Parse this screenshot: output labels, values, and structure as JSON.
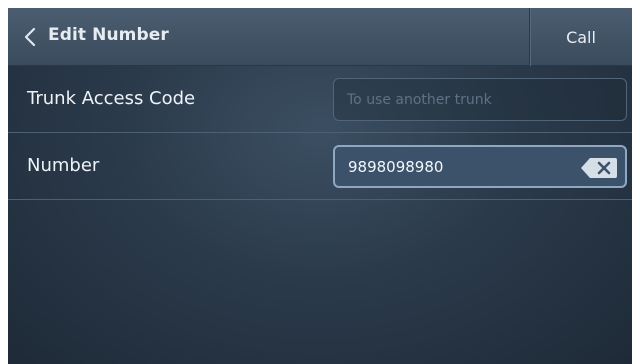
{
  "header": {
    "title": "Edit Number",
    "call_label": "Call"
  },
  "form": {
    "trunk": {
      "label": "Trunk Access Code",
      "value": "",
      "placeholder": "To use another trunk"
    },
    "number": {
      "label": "Number",
      "value": "9898098980"
    }
  },
  "icons": {
    "back": "chevron-left-icon",
    "clear": "backspace-clear-icon"
  },
  "colors": {
    "header_bg": "#43566a",
    "body_bg": "#2b3a4b",
    "active_field_border": "#8fa8c2",
    "text": "#eef3f8"
  }
}
